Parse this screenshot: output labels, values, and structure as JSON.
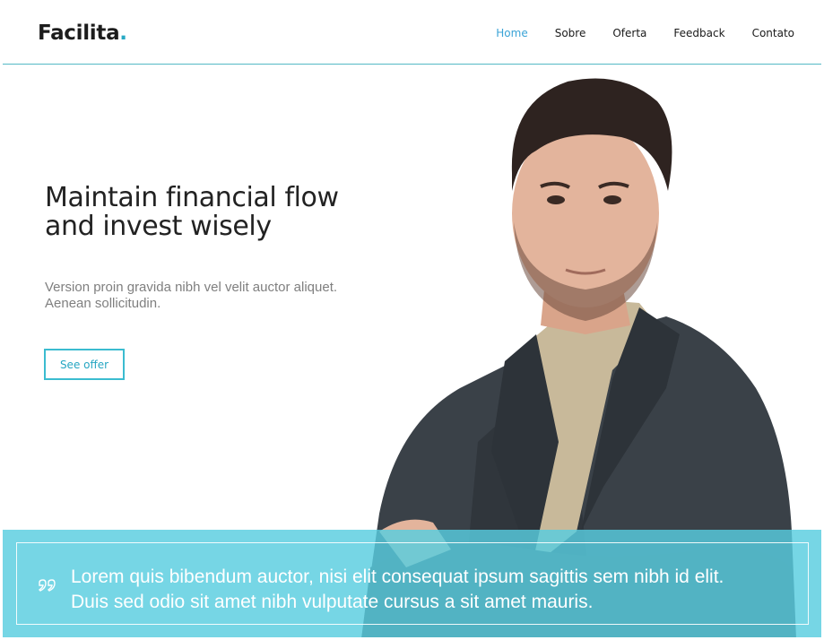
{
  "header": {
    "logo_text": "Facilita",
    "logo_dot": ".",
    "nav": [
      {
        "label": "Home",
        "active": true
      },
      {
        "label": "Sobre",
        "active": false
      },
      {
        "label": "Oferta",
        "active": false
      },
      {
        "label": "Feedback",
        "active": false
      },
      {
        "label": "Contato",
        "active": false
      }
    ]
  },
  "hero": {
    "headline_line1": "Maintain financial flow",
    "headline_line2": "and invest wisely",
    "subtext_line1": "Version proin gravida nibh vel velit auctor aliquet.",
    "subtext_line2": "Aenean sollicitudin.",
    "cta_label": "See offer"
  },
  "quote": {
    "icon": "quote-icon",
    "line1": "Lorem quis bibendum auctor, nisi elit consequat ipsum sagittis sem nibh id elit.",
    "line2": "Duis sed odio sit amet nibh vulputate cursus a sit amet mauris."
  },
  "colors": {
    "accent": "#3bbcd0",
    "nav_active": "#3aa3d6",
    "banner": "#58cddf",
    "text_dark": "#222222",
    "text_muted": "#7f7f7f"
  }
}
